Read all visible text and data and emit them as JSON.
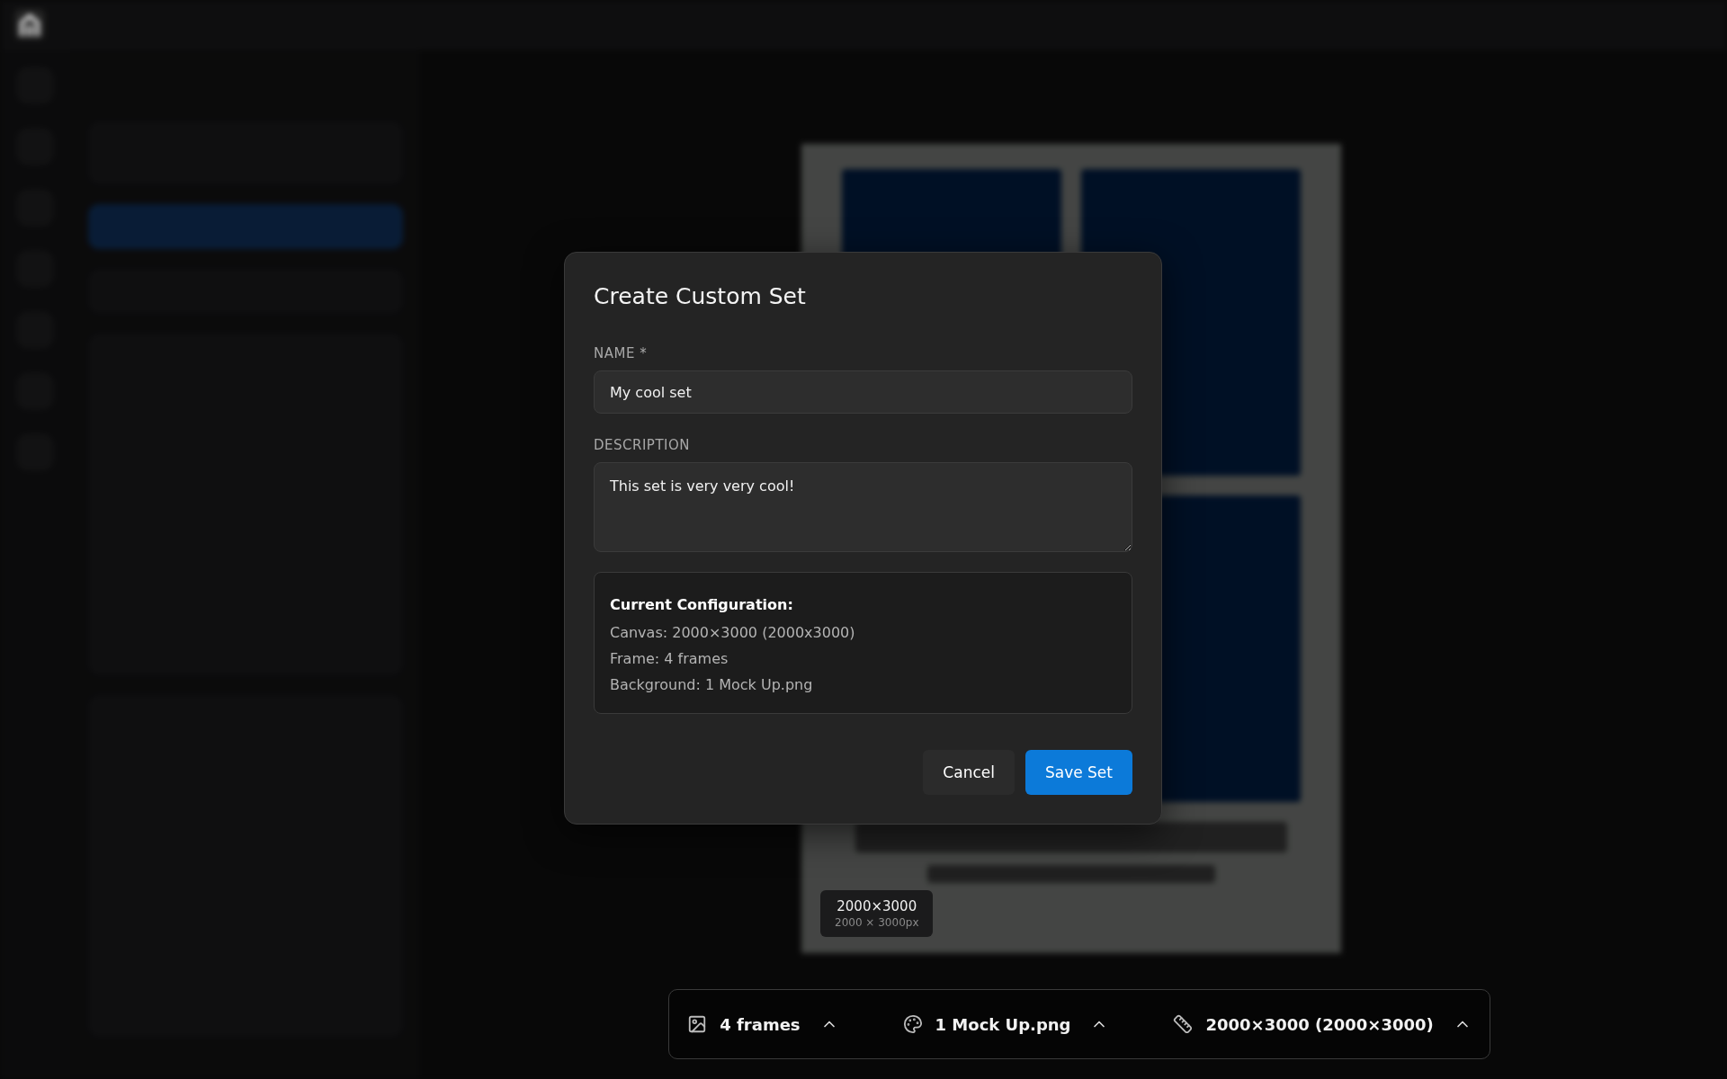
{
  "size_badge": {
    "title": "2000×3000",
    "subtitle": "2000 × 3000px"
  },
  "dialog": {
    "title": "Create Custom Set",
    "fields": [
      {
        "kind": "input",
        "label": "NAME *",
        "value": "My cool set"
      },
      {
        "kind": "textarea",
        "label": "DESCRIPTION",
        "value": "This set is very very cool!"
      }
    ],
    "summary": {
      "heading": "Current Configuration:",
      "lines": [
        "Canvas: 2000×3000 (2000x3000)",
        "Frame: 4 frames",
        "Background: 1 Mock Up.png"
      ]
    },
    "buttons": [
      {
        "kind": "secondary",
        "label": "Cancel"
      },
      {
        "kind": "primary",
        "label": "Save Set"
      }
    ]
  },
  "toolbar": {
    "items": [
      {
        "kind": "frames",
        "label": "4 frames"
      },
      {
        "kind": "background",
        "label": "1 Mock Up.png"
      },
      {
        "kind": "size",
        "label": "2000×3000 (2000×3000)"
      }
    ]
  }
}
